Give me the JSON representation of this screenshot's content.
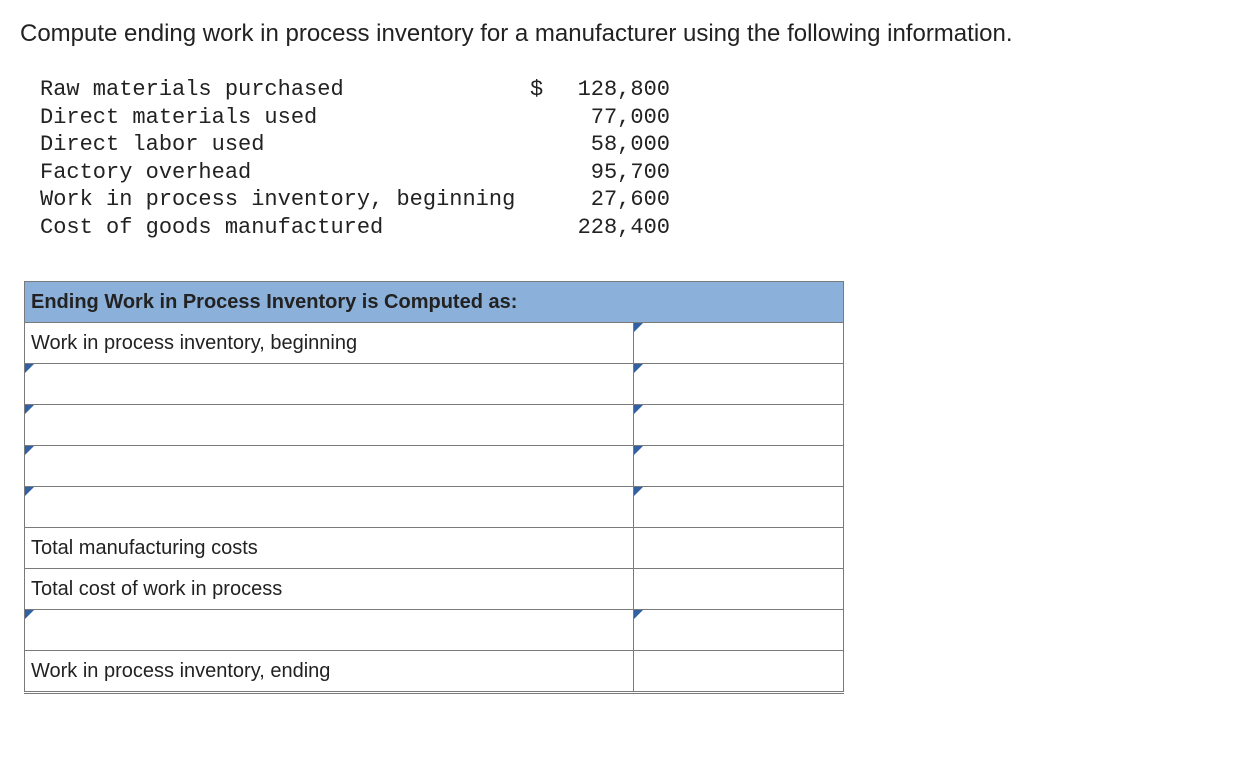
{
  "instruction": "Compute ending work in process inventory for a manufacturer using the following information.",
  "given": {
    "rows": [
      {
        "label": "Raw materials purchased",
        "currency": "$",
        "value": "128,800"
      },
      {
        "label": "Direct materials used",
        "currency": "",
        "value": "77,000"
      },
      {
        "label": "Direct labor used",
        "currency": "",
        "value": "58,000"
      },
      {
        "label": "Factory overhead",
        "currency": "",
        "value": "95,700"
      },
      {
        "label": "Work in process inventory, beginning",
        "currency": "",
        "value": "27,600"
      },
      {
        "label": "Cost of goods manufactured",
        "currency": "",
        "value": "228,400"
      }
    ]
  },
  "answer_table": {
    "header": "Ending Work in Process Inventory is Computed as:",
    "rows": [
      {
        "label": "Work in process inventory, beginning",
        "label_editable": false,
        "value": "",
        "value_editable": true
      },
      {
        "label": "",
        "label_editable": true,
        "value": "",
        "value_editable": true
      },
      {
        "label": "",
        "label_editable": true,
        "value": "",
        "value_editable": true
      },
      {
        "label": "",
        "label_editable": true,
        "value": "",
        "value_editable": true
      },
      {
        "label": "",
        "label_editable": true,
        "value": "",
        "value_editable": true
      },
      {
        "label": "Total manufacturing costs",
        "label_editable": false,
        "value": "",
        "value_editable": false
      },
      {
        "label": "Total cost of work in process",
        "label_editable": false,
        "value": "",
        "value_editable": false
      },
      {
        "label": "",
        "label_editable": true,
        "value": "",
        "value_editable": true
      },
      {
        "label": "Work in process inventory, ending",
        "label_editable": false,
        "value": "",
        "value_editable": false
      }
    ]
  }
}
